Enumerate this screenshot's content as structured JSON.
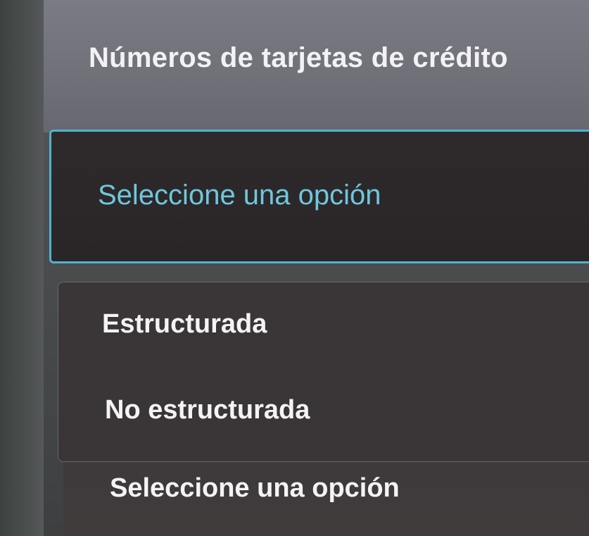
{
  "question": {
    "label": "Números de tarjetas de crédito"
  },
  "select": {
    "placeholder": "Seleccione una opción",
    "accent_color": "#4fb3cf"
  },
  "dropdown": {
    "options": [
      {
        "label": "Estructurada"
      },
      {
        "label": "No estructurada"
      }
    ]
  },
  "next_select": {
    "placeholder": "Seleccione una opción"
  }
}
